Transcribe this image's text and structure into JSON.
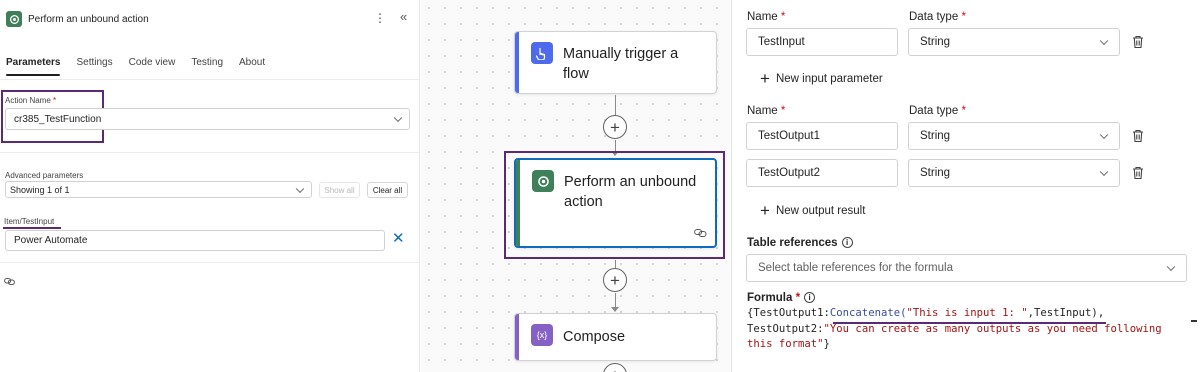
{
  "left_panel": {
    "title": "Perform an unbound action",
    "more_icon": "more-vertical-icon",
    "collapse_icon": "chevron-double-left-icon",
    "tabs": [
      {
        "label": "Parameters",
        "active": true
      },
      {
        "label": "Settings",
        "active": false
      },
      {
        "label": "Code view",
        "active": false
      },
      {
        "label": "Testing",
        "active": false
      },
      {
        "label": "About",
        "active": false
      }
    ],
    "action_name_label": "Action Name",
    "action_name_value": "cr385_TestFunction",
    "advanced_label": "Advanced parameters",
    "advanced_value": "Showing 1 of 1",
    "show_all_label": "Show all",
    "clear_all_label": "Clear all",
    "item_label": "Item/TestInput",
    "item_value": "Power Automate"
  },
  "canvas": {
    "trigger_title_line1": "Manually trigger a",
    "trigger_title_line2": "flow",
    "action_title_line1": "Perform an unbound",
    "action_title_line2": "action",
    "compose_title": "Compose"
  },
  "right_panel": {
    "inputs_name_header": "Name",
    "inputs_type_header": "Data type",
    "input_name": "TestInput",
    "input_type": "String",
    "new_input_label": "New input parameter",
    "outputs_name_header": "Name",
    "outputs_type_header": "Data type",
    "outputs": [
      {
        "name": "TestOutput1",
        "type": "String"
      },
      {
        "name": "TestOutput2",
        "type": "String"
      }
    ],
    "new_output_label": "New output result",
    "table_references_label": "Table references",
    "table_references_placeholder": "Select table references for the formula",
    "formula_label": "Formula",
    "formula": {
      "p1": "{TestOutput1:",
      "p2": "Concatenate(",
      "p3": "\"This is input 1: \"",
      "p4": ",TestInput),",
      "p5": "TestOutput2:",
      "p6": "\"You can create as many outputs as you need following",
      "p7": "this format\"",
      "p8": "}"
    }
  },
  "colors": {
    "highlight": "#5b2a72",
    "trigger_accent": "#4f6bed",
    "dataverse_green": "#3f7f5a",
    "compose_purple": "#8661c5",
    "link_blue": "#0f6cbd"
  }
}
